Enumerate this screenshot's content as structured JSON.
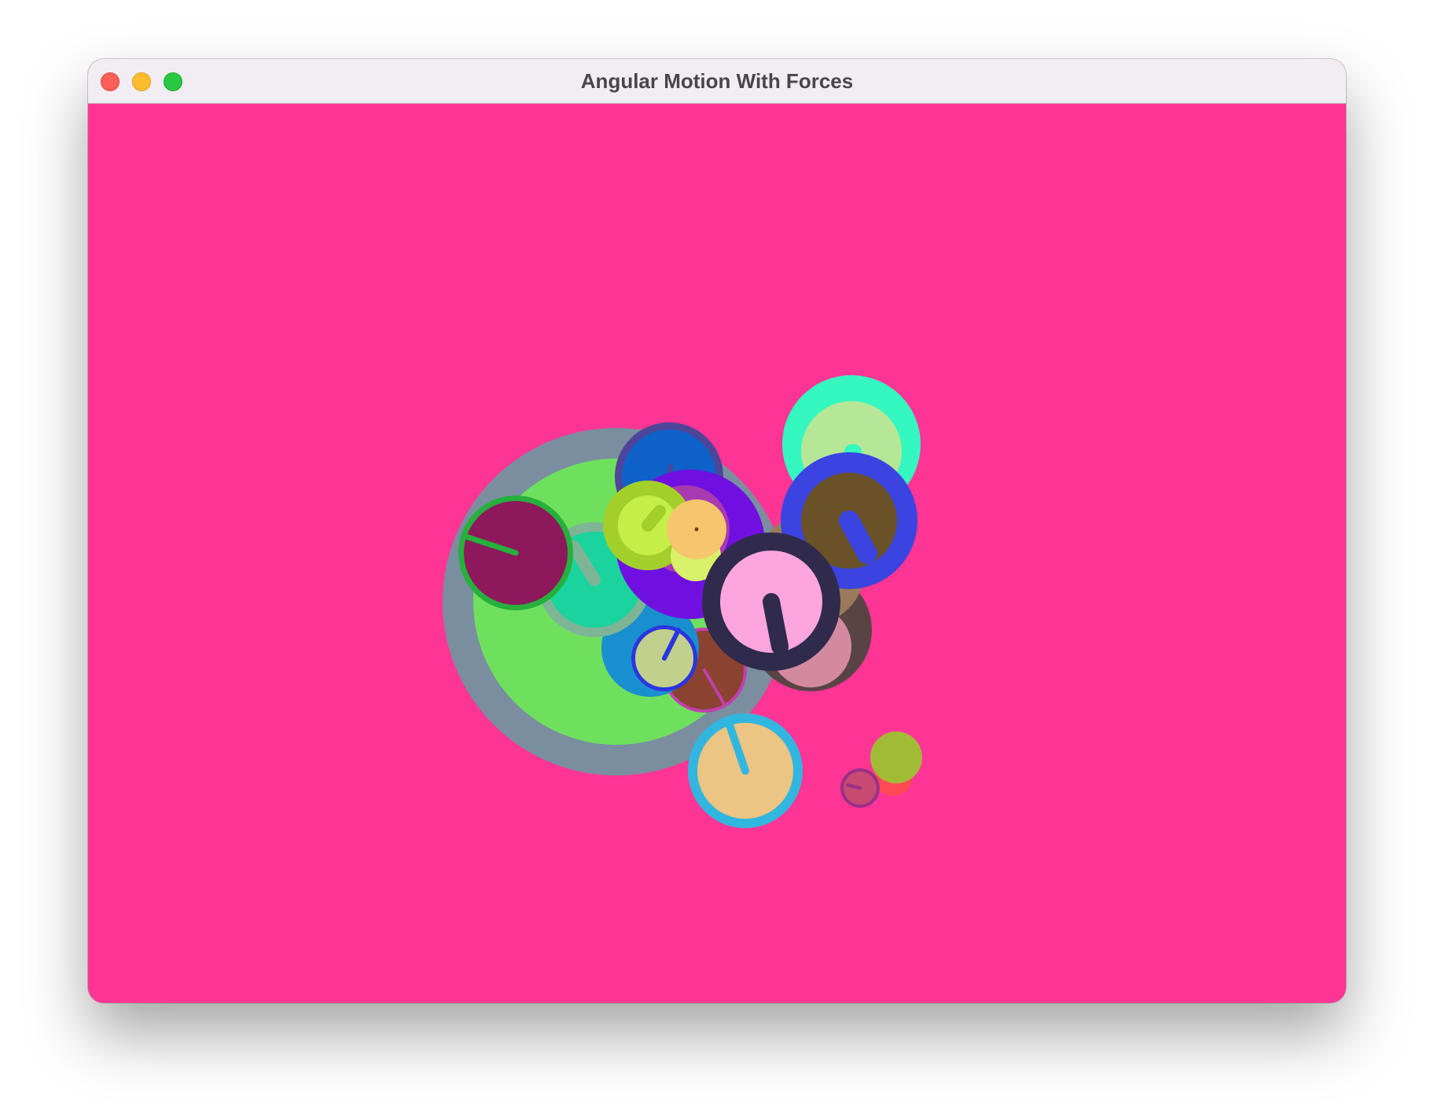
{
  "window": {
    "title": "Angular Motion With Forces"
  },
  "canvas": {
    "background": "#ff3595"
  },
  "bodies": [
    {
      "fill": "#7a8ea0",
      "stroke": "#7a8ea0",
      "pointer": null
    },
    {
      "fill": "#6fe05e",
      "stroke": "#6fe05e",
      "pointer": null
    },
    {
      "fill": "#8b4230",
      "stroke": "#c23fb0",
      "pointer": "#c23fb0"
    },
    {
      "fill": "#1a8fcf",
      "stroke": "#0f87ce",
      "pointer": null
    },
    {
      "fill": "#1bd39c",
      "stroke": "#7db596",
      "pointer": "#7db596"
    },
    {
      "fill": "#5a4345",
      "stroke": "#5a4345",
      "pointer": null
    },
    {
      "fill": "#dbb7c5",
      "stroke": "#dbb7c5",
      "pointer": null
    },
    {
      "fill": "#9a7a5a",
      "stroke": "#9a7a5a",
      "pointer": null
    },
    {
      "fill": "#0e62c9",
      "stroke": "#4e4599",
      "pointer": "#4e4599"
    },
    {
      "fill": "#35f7c0",
      "stroke": "#35f7c0",
      "pointer": null
    },
    {
      "fill": "#b5e796",
      "stroke": "#35f7c0",
      "pointer": "#35f7c0"
    },
    {
      "fill": "#7010e0",
      "stroke": "#7010e0",
      "pointer": null
    },
    {
      "fill": "#a93ab0",
      "stroke": "#a93ab0",
      "pointer": null
    },
    {
      "fill": "#c5ef47",
      "stroke": "#a3cf2a",
      "pointer": "#a3cf2a"
    },
    {
      "fill": "#d9f06a",
      "stroke": "#d9f06a",
      "pointer": null
    },
    {
      "fill": "#f5c66c",
      "stroke": "#f5c66c",
      "pointer": "#8a3b10"
    },
    {
      "fill": "#d38aa0",
      "stroke": "#d38aa0",
      "pointer": null
    },
    {
      "fill": "#8e185c",
      "stroke": "#26b03c",
      "pointer": "#26b03c"
    },
    {
      "fill": "#6a5128",
      "stroke": "#3b44e0",
      "pointer": "#3b44e0"
    },
    {
      "fill": "#fda5dd",
      "stroke": "#302b4c",
      "pointer": "#302b4c"
    },
    {
      "fill": "#c1d18d",
      "stroke": "#2b35df",
      "pointer": "#2b35df"
    },
    {
      "fill": "#ecc483",
      "stroke": "#31b6e0",
      "pointer": "#31b6e0"
    },
    {
      "fill": "#ff4a55",
      "stroke": "#ff4a55",
      "pointer": null
    },
    {
      "fill": "#a2bb36",
      "stroke": "#a2bb36",
      "pointer": null
    },
    {
      "fill": "#c84a72",
      "stroke": "#9a3086",
      "pointer": "#9a3086"
    }
  ]
}
